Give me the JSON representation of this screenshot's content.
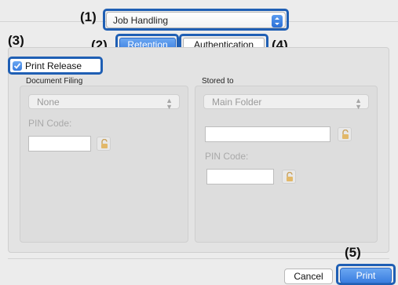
{
  "callouts": {
    "c1": "(1)",
    "c2": "(2)",
    "c3": "(3)",
    "c4": "(4)",
    "c5": "(5)"
  },
  "top_select": {
    "value": "Job Handling"
  },
  "tabs": [
    {
      "label": "Retention",
      "active": true
    },
    {
      "label": "Authentication",
      "active": false
    }
  ],
  "print_release": {
    "label": "Print Release",
    "checked": true
  },
  "document_filing": {
    "title": "Document Filing",
    "select_value": "None",
    "pin_label": "PIN Code:"
  },
  "stored_to": {
    "title": "Stored to",
    "select_value": "Main Folder",
    "pin_label": "PIN Code:"
  },
  "buttons": {
    "cancel": "Cancel",
    "print": "Print"
  },
  "colors": {
    "accent": "#3a7ddf",
    "callout_ring": "#1f5fb4"
  },
  "icons": {
    "lock": "lock-icon",
    "checkmark": "checkmark-icon",
    "select_arrows": "up-down-chevron-icon"
  }
}
